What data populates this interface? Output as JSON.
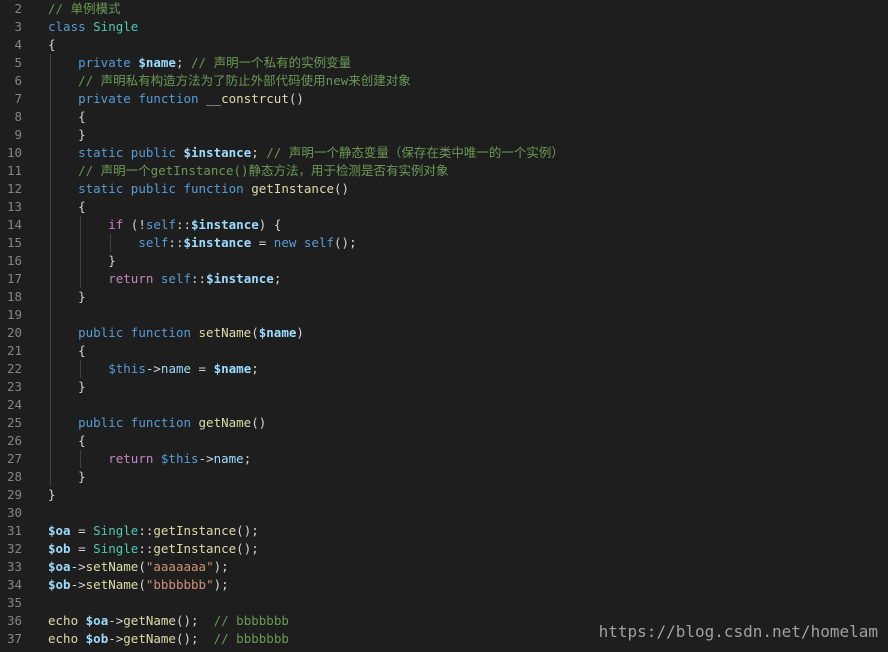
{
  "colors": {
    "background": "#1e1e1e",
    "line_number": "#858585",
    "keyword": "#569cd6",
    "control": "#c586c0",
    "class_name": "#4ec9b0",
    "function_name": "#dcdcaa",
    "variable": "#9cdcfe",
    "string": "#ce9178",
    "comment": "#6a9955",
    "punctuation": "#d4d4d4"
  },
  "lines": [
    {
      "num": "2",
      "tokens": [
        [
          "// 单例模式",
          "cm"
        ]
      ]
    },
    {
      "num": "3",
      "tokens": [
        [
          "class ",
          "kw"
        ],
        [
          "Single",
          "cls"
        ]
      ]
    },
    {
      "num": "4",
      "tokens": [
        [
          "{",
          "p"
        ]
      ]
    },
    {
      "num": "5",
      "tokens": [
        [
          "    ",
          "p"
        ],
        [
          "private ",
          "kw"
        ],
        [
          "$name",
          "var-b"
        ],
        [
          "; ",
          "p"
        ],
        [
          "// 声明一个私有的实例变量",
          "cm"
        ]
      ]
    },
    {
      "num": "6",
      "tokens": [
        [
          "    ",
          "p"
        ],
        [
          "// 声明私有构造方法为了防止外部代码使用new来创建对象",
          "cm"
        ]
      ]
    },
    {
      "num": "7",
      "tokens": [
        [
          "    ",
          "p"
        ],
        [
          "private ",
          "kw"
        ],
        [
          "function ",
          "kw"
        ],
        [
          "__constrcut",
          "fn"
        ],
        [
          "()",
          "p"
        ]
      ]
    },
    {
      "num": "8",
      "tokens": [
        [
          "    {",
          "p"
        ]
      ]
    },
    {
      "num": "9",
      "tokens": [
        [
          "    }",
          "p"
        ]
      ]
    },
    {
      "num": "10",
      "tokens": [
        [
          "    ",
          "p"
        ],
        [
          "static ",
          "kw"
        ],
        [
          "public ",
          "kw"
        ],
        [
          "$instance",
          "var-b"
        ],
        [
          "; ",
          "p"
        ],
        [
          "// 声明一个静态变量（保存在类中唯一的一个实例）",
          "cm"
        ]
      ]
    },
    {
      "num": "11",
      "tokens": [
        [
          "    ",
          "p"
        ],
        [
          "// 声明一个getInstance()静态方法，用于检测是否有实例对象",
          "cm"
        ]
      ]
    },
    {
      "num": "12",
      "tokens": [
        [
          "    ",
          "p"
        ],
        [
          "static ",
          "kw"
        ],
        [
          "public ",
          "kw"
        ],
        [
          "function ",
          "kw"
        ],
        [
          "getInstance",
          "fn"
        ],
        [
          "()",
          "p"
        ]
      ]
    },
    {
      "num": "13",
      "tokens": [
        [
          "    {",
          "p"
        ]
      ]
    },
    {
      "num": "14",
      "tokens": [
        [
          "        ",
          "p"
        ],
        [
          "if ",
          "ctrl"
        ],
        [
          "(!",
          "p"
        ],
        [
          "self",
          "kw"
        ],
        [
          "::",
          "p"
        ],
        [
          "$instance",
          "var-b"
        ],
        [
          ") {",
          "p"
        ]
      ]
    },
    {
      "num": "15",
      "tokens": [
        [
          "            ",
          "p"
        ],
        [
          "self",
          "kw"
        ],
        [
          "::",
          "p"
        ],
        [
          "$instance",
          "var-b"
        ],
        [
          " = ",
          "p"
        ],
        [
          "new ",
          "kw"
        ],
        [
          "self",
          "kw"
        ],
        [
          "();",
          "p"
        ]
      ]
    },
    {
      "num": "16",
      "tokens": [
        [
          "        }",
          "p"
        ]
      ]
    },
    {
      "num": "17",
      "tokens": [
        [
          "        ",
          "p"
        ],
        [
          "return ",
          "ctrl"
        ],
        [
          "self",
          "kw"
        ],
        [
          "::",
          "p"
        ],
        [
          "$instance",
          "var-b"
        ],
        [
          ";",
          "p"
        ]
      ]
    },
    {
      "num": "18",
      "tokens": [
        [
          "    }",
          "p"
        ]
      ]
    },
    {
      "num": "19",
      "tokens": []
    },
    {
      "num": "20",
      "tokens": [
        [
          "    ",
          "p"
        ],
        [
          "public ",
          "kw"
        ],
        [
          "function ",
          "kw"
        ],
        [
          "setName",
          "fn"
        ],
        [
          "(",
          "p"
        ],
        [
          "$name",
          "var-b"
        ],
        [
          ")",
          "p"
        ]
      ]
    },
    {
      "num": "21",
      "tokens": [
        [
          "    {",
          "p"
        ]
      ]
    },
    {
      "num": "22",
      "tokens": [
        [
          "        ",
          "p"
        ],
        [
          "$this",
          "kw"
        ],
        [
          "->",
          "p"
        ],
        [
          "name",
          "var"
        ],
        [
          " = ",
          "p"
        ],
        [
          "$name",
          "var-b"
        ],
        [
          ";",
          "p"
        ]
      ]
    },
    {
      "num": "23",
      "tokens": [
        [
          "    }",
          "p"
        ]
      ]
    },
    {
      "num": "24",
      "tokens": []
    },
    {
      "num": "25",
      "tokens": [
        [
          "    ",
          "p"
        ],
        [
          "public ",
          "kw"
        ],
        [
          "function ",
          "kw"
        ],
        [
          "getName",
          "fn"
        ],
        [
          "()",
          "p"
        ]
      ]
    },
    {
      "num": "26",
      "tokens": [
        [
          "    {",
          "p"
        ]
      ]
    },
    {
      "num": "27",
      "tokens": [
        [
          "        ",
          "p"
        ],
        [
          "return ",
          "ctrl"
        ],
        [
          "$this",
          "kw"
        ],
        [
          "->",
          "p"
        ],
        [
          "name",
          "var"
        ],
        [
          ";",
          "p"
        ]
      ]
    },
    {
      "num": "28",
      "tokens": [
        [
          "    }",
          "p"
        ]
      ]
    },
    {
      "num": "29",
      "tokens": [
        [
          "}",
          "p"
        ]
      ]
    },
    {
      "num": "30",
      "tokens": []
    },
    {
      "num": "31",
      "tokens": [
        [
          "$oa",
          "var-b"
        ],
        [
          " = ",
          "p"
        ],
        [
          "Single",
          "cls"
        ],
        [
          "::",
          "p"
        ],
        [
          "getInstance",
          "fn"
        ],
        [
          "();",
          "p"
        ]
      ]
    },
    {
      "num": "32",
      "tokens": [
        [
          "$ob",
          "var-b"
        ],
        [
          " = ",
          "p"
        ],
        [
          "Single",
          "cls"
        ],
        [
          "::",
          "p"
        ],
        [
          "getInstance",
          "fn"
        ],
        [
          "();",
          "p"
        ]
      ]
    },
    {
      "num": "33",
      "tokens": [
        [
          "$oa",
          "var-b"
        ],
        [
          "->",
          "p"
        ],
        [
          "setName",
          "fn"
        ],
        [
          "(",
          "p"
        ],
        [
          "\"aaaaaaa\"",
          "str"
        ],
        [
          ");",
          "p"
        ]
      ]
    },
    {
      "num": "34",
      "tokens": [
        [
          "$ob",
          "var-b"
        ],
        [
          "->",
          "p"
        ],
        [
          "setName",
          "fn"
        ],
        [
          "(",
          "p"
        ],
        [
          "\"bbbbbbb\"",
          "str"
        ],
        [
          ");",
          "p"
        ]
      ]
    },
    {
      "num": "35",
      "tokens": []
    },
    {
      "num": "36",
      "tokens": [
        [
          "echo ",
          "fn"
        ],
        [
          "$oa",
          "var-b"
        ],
        [
          "->",
          "p"
        ],
        [
          "getName",
          "fn"
        ],
        [
          "();  ",
          "p"
        ],
        [
          "// bbbbbbb",
          "cm"
        ]
      ]
    },
    {
      "num": "37",
      "tokens": [
        [
          "echo ",
          "fn"
        ],
        [
          "$ob",
          "var-b"
        ],
        [
          "->",
          "p"
        ],
        [
          "getName",
          "fn"
        ],
        [
          "();  ",
          "p"
        ],
        [
          "// bbbbbbb",
          "cm"
        ]
      ]
    }
  ],
  "watermark": "https://blog.csdn.net/homelam"
}
